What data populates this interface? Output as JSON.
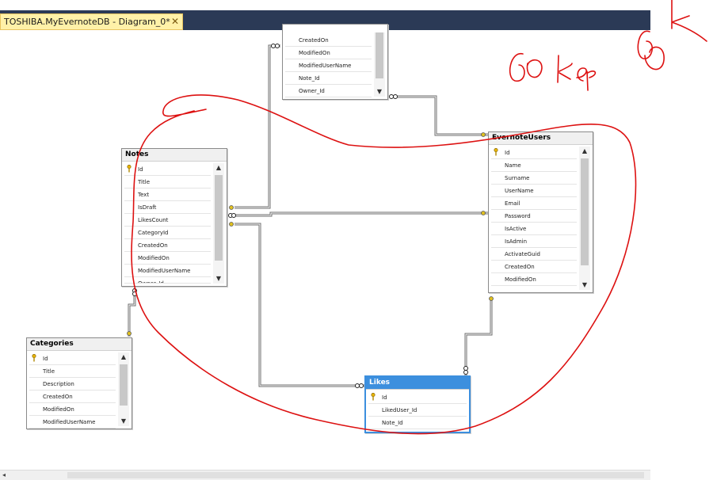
{
  "tab": {
    "title": "TOSHIBA.MyEvernoteDB - Diagram_0*",
    "close": "✕"
  },
  "tables": {
    "top": {
      "rows": [
        "CreatedOn",
        "ModifiedOn",
        "ModifiedUserName",
        "Note_Id",
        "Owner_Id"
      ]
    },
    "notes": {
      "title": "Notes",
      "rows": [
        "Id",
        "Title",
        "Text",
        "IsDraft",
        "LikesCount",
        "CategoryId",
        "CreatedOn",
        "ModifiedOn",
        "ModifiedUserName",
        "Owner_Id"
      ]
    },
    "evernote_users": {
      "title": "EvernoteUsers",
      "rows": [
        "Id",
        "Name",
        "Surname",
        "UserName",
        "Email",
        "Password",
        "IsActive",
        "IsAdmin",
        "ActivateGuid",
        "CreatedOn",
        "ModifiedOn"
      ]
    },
    "categories": {
      "title": "Categories",
      "rows": [
        "Id",
        "Title",
        "Description",
        "CreatedOn",
        "ModifiedOn",
        "ModifiedUserName"
      ]
    },
    "likes": {
      "title": "Likes",
      "rows": [
        "Id",
        "LikedUser_Id",
        "Note_Id"
      ]
    }
  },
  "scroll_arrows": {
    "up": "▲",
    "down": "▼",
    "left": "◂"
  },
  "colors": {
    "tab_bar": "#2b3a56",
    "tab_active": "#fff1a8",
    "selection": "#3c8fde",
    "annotation": "#dd1111"
  }
}
